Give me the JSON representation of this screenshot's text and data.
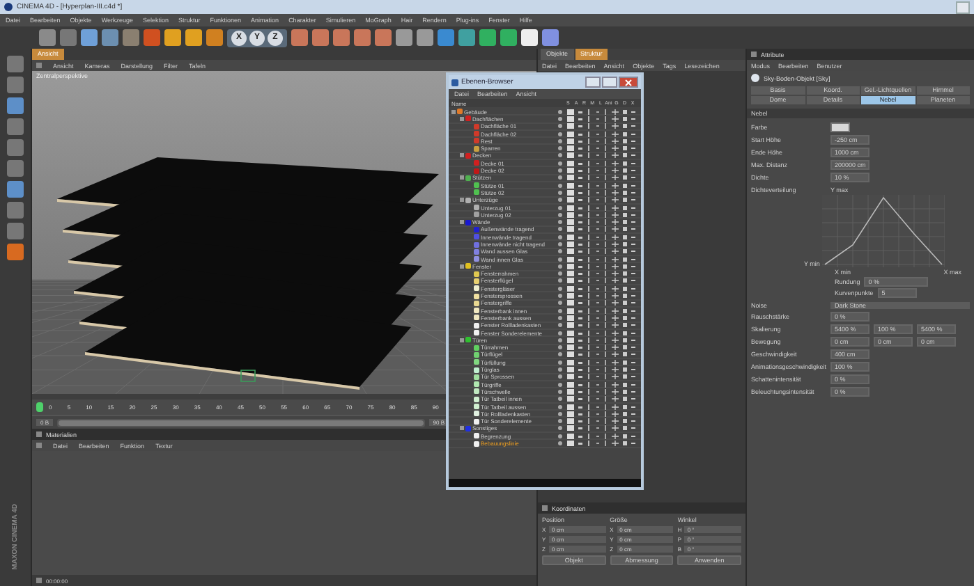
{
  "window": {
    "title": "CINEMA 4D - [Hyperplan-III.c4d *]"
  },
  "menu": [
    "Datei",
    "Bearbeiten",
    "Objekte",
    "Werkzeuge",
    "Selektion",
    "Struktur",
    "Funktionen",
    "Animation",
    "Charakter",
    "Simulieren",
    "MoGraph",
    "Hair",
    "Rendern",
    "Plug-ins",
    "Fenster",
    "Hilfe"
  ],
  "axis_buttons": [
    "X",
    "Y",
    "Z"
  ],
  "viewport": {
    "tab": "Ansicht",
    "menu": [
      "Ansicht",
      "Kameras",
      "Darstellung",
      "Filter",
      "Tafeln"
    ],
    "label": "Zentralperspektive"
  },
  "timeline": {
    "ticks": [
      "0",
      "5",
      "10",
      "15",
      "20",
      "25",
      "30",
      "35",
      "40",
      "45",
      "50",
      "55",
      "60",
      "65",
      "70",
      "75",
      "80",
      "85",
      "90"
    ],
    "start": "0 B",
    "end": "90 B",
    "range": {
      "level": 1
    }
  },
  "materials": {
    "title": "Materialien",
    "menu": [
      "Datei",
      "Bearbeiten",
      "Funktion",
      "Textur"
    ]
  },
  "logo": "MAXON CINEMA 4D",
  "status_bar": "00:00:00",
  "object_manager": {
    "tabs": [
      {
        "label": "Objekte",
        "selected": false
      },
      {
        "label": "Struktur",
        "selected": true
      }
    ],
    "menu": [
      "Datei",
      "Bearbeiten",
      "Ansicht",
      "Objekte",
      "Tags",
      "Lesezeichen"
    ]
  },
  "layer_browser": {
    "title": "Ebenen-Browser",
    "menu": [
      "Datei",
      "Bearbeiten",
      "Ansicht"
    ],
    "columns": [
      "Name",
      "S",
      "A",
      "R",
      "M",
      "L",
      "Ani",
      "G",
      "D",
      "X"
    ],
    "layers": [
      {
        "name": "Gebäude",
        "color": "#e07a2a",
        "selected": false,
        "children": [
          {
            "name": "Dachflächen",
            "color": "#d02020",
            "selected": false,
            "children": [
              {
                "name": "Dachfläche 01",
                "color": "#d03a2a",
                "selected": false
              },
              {
                "name": "Dachfläche 02",
                "color": "#d03a2a",
                "selected": false
              },
              {
                "name": "Rest",
                "color": "#d03a2a",
                "selected": false
              },
              {
                "name": "Sparren",
                "color": "#c8a040",
                "selected": false
              }
            ]
          },
          {
            "name": "Decken",
            "color": "#d02020",
            "selected": false,
            "children": [
              {
                "name": "Decke 01",
                "color": "#d02020",
                "selected": false
              },
              {
                "name": "Decke 02",
                "color": "#c01818",
                "selected": false
              }
            ]
          },
          {
            "name": "Stützen",
            "color": "#50b050",
            "selected": false,
            "children": [
              {
                "name": "Stütze 01",
                "color": "#50c050",
                "selected": false
              },
              {
                "name": "Stütze 02",
                "color": "#50c050",
                "selected": false
              }
            ]
          },
          {
            "name": "Unterzüge",
            "color": "#b0b0b0",
            "selected": false,
            "children": [
              {
                "name": "Unterzug 01",
                "color": "#b0b0b0",
                "selected": false
              },
              {
                "name": "Unterzug 02",
                "color": "#a0a0a0",
                "selected": false
              }
            ]
          },
          {
            "name": "Wände",
            "color": "#1818d0",
            "selected": false,
            "children": [
              {
                "name": "Außenwände tragend",
                "color": "#2020d0",
                "selected": false
              },
              {
                "name": "Innenwände tragend",
                "color": "#5050e0",
                "selected": false
              },
              {
                "name": "Innenwände nicht tragend",
                "color": "#7070e0",
                "selected": false
              },
              {
                "name": "Wand aussen Glas",
                "color": "#8080e0",
                "selected": false
              },
              {
                "name": "Wand innen Glas",
                "color": "#9090e0",
                "selected": false
              }
            ]
          },
          {
            "name": "Fenster",
            "color": "#e0c020",
            "selected": false,
            "children": [
              {
                "name": "Fensterrahmen",
                "color": "#e0c850",
                "selected": false
              },
              {
                "name": "Fensterflügel",
                "color": "#e8d070",
                "selected": false
              },
              {
                "name": "Fenstergläser",
                "color": "#f0f0d0",
                "selected": false
              },
              {
                "name": "Fenstersprossen",
                "color": "#f0e0a0",
                "selected": false
              },
              {
                "name": "Fenstergriffe",
                "color": "#e8d890",
                "selected": false
              },
              {
                "name": "Fensterbank innen",
                "color": "#f0e8c0",
                "selected": false
              },
              {
                "name": "Fensterbank aussen",
                "color": "#f0e8c0",
                "selected": false
              },
              {
                "name": "Fenster Rollladenkasten",
                "color": "#f0f0f0",
                "selected": false
              },
              {
                "name": "Fenster Sonderelemente",
                "color": "#f0f0f0",
                "selected": false
              }
            ]
          },
          {
            "name": "Türen",
            "color": "#30c030",
            "selected": false,
            "children": [
              {
                "name": "Türrahmen",
                "color": "#60d060",
                "selected": false
              },
              {
                "name": "Türflügel",
                "color": "#70d070",
                "selected": false
              },
              {
                "name": "Türfüllung",
                "color": "#80d880",
                "selected": false
              },
              {
                "name": "Türglas",
                "color": "#c0f0d0",
                "selected": false
              },
              {
                "name": "Tür Sprossen",
                "color": "#a0e0a0",
                "selected": false
              },
              {
                "name": "Türgriffe",
                "color": "#b0e8b0",
                "selected": false
              },
              {
                "name": "Türschwelle",
                "color": "#c0e8c0",
                "selected": false
              },
              {
                "name": "Tür Tatbeil innen",
                "color": "#d0f0d0",
                "selected": false
              },
              {
                "name": "Tür Tatbeil aussen",
                "color": "#d0f0d0",
                "selected": false
              },
              {
                "name": "Tür Rollladenkasten",
                "color": "#e0f0e0",
                "selected": false
              },
              {
                "name": "Tür Sonderelemente",
                "color": "#f0f0f0",
                "selected": false
              }
            ]
          },
          {
            "name": "Sonstiges",
            "color": "#2030e0",
            "selected": false,
            "children": [
              {
                "name": "Begrenzung",
                "color": "#f0f0f0",
                "selected": false
              },
              {
                "name": "Bebauungslinie",
                "color": "#f0f0f0",
                "selected": true
              }
            ]
          }
        ]
      }
    ]
  },
  "attributes": {
    "title": "Attribute",
    "menu": [
      "Modus",
      "Bearbeiten",
      "Benutzer"
    ],
    "object": "Sky-Boden-Objekt [Sky]",
    "tabs": [
      {
        "label": "Basis",
        "selected": false
      },
      {
        "label": "Koord.",
        "selected": false
      },
      {
        "label": "Gel.-Lichtquellen",
        "selected": false
      },
      {
        "label": "Himmel",
        "selected": false
      },
      {
        "label": "Dome",
        "selected": false
      },
      {
        "label": "Details",
        "selected": false
      },
      {
        "label": "Nebel",
        "selected": true
      },
      {
        "label": "Planeten",
        "selected": false
      }
    ],
    "section": "Nebel",
    "params": [
      {
        "kind": "color",
        "label": "Farbe",
        "color": "#d8d8d8"
      },
      {
        "kind": "field",
        "label": "Start Höhe",
        "values": [
          "-250 cm"
        ]
      },
      {
        "kind": "field",
        "label": "Ende Höhe",
        "values": [
          "1000 cm"
        ]
      },
      {
        "kind": "field",
        "label": "Max. Distanz",
        "values": [
          "200000 cm"
        ]
      },
      {
        "kind": "field",
        "label": "Dichte",
        "values": [
          "10 %"
        ]
      },
      {
        "kind": "curve",
        "label": "Dichteverteilung",
        "ymax": "Y max",
        "ymin": "Y min",
        "xmin": "X min",
        "xmax": "X max",
        "rounding_label": "Rundung",
        "rounding": "0 %",
        "points_label": "Kurvenpunkte",
        "points": "5"
      },
      {
        "kind": "dropdown",
        "label": "Noise",
        "values": [
          "Dark Stone"
        ]
      },
      {
        "kind": "field",
        "label": "Rauschstärke",
        "values": [
          "0 %"
        ]
      },
      {
        "kind": "field",
        "label": "Skalierung",
        "values": [
          "5400 %",
          "100 %",
          "5400 %"
        ]
      },
      {
        "kind": "field",
        "label": "Bewegung",
        "values": [
          "0 cm",
          "0 cm",
          "0 cm"
        ]
      },
      {
        "kind": "field",
        "label": "Geschwindigkeit",
        "values": [
          "400 cm"
        ]
      },
      {
        "kind": "field",
        "label": "Animationsgeschwindigkeit",
        "values": [
          "100 %"
        ]
      },
      {
        "kind": "field",
        "label": "Schattenintensität",
        "values": [
          "0 %"
        ]
      },
      {
        "kind": "field",
        "label": "Beleuchtungsintensität",
        "values": [
          "0 %"
        ]
      }
    ]
  },
  "coordinates": {
    "title": "Koordinaten",
    "columns": [
      "Position",
      "Größe",
      "Winkel"
    ],
    "rows": [
      {
        "axis": "X",
        "position": "0 cm",
        "size_axis": "X",
        "size": "0 cm",
        "angle_axis": "H",
        "angle": "0 °"
      },
      {
        "axis": "Y",
        "position": "0 cm",
        "size_axis": "Y",
        "size": "0 cm",
        "angle_axis": "P",
        "angle": "0 °"
      },
      {
        "axis": "Z",
        "position": "0 cm",
        "size_axis": "Z",
        "size": "0 cm",
        "angle_axis": "B",
        "angle": "0 °"
      }
    ],
    "buttons": [
      "Objekt",
      "Abmessung",
      "Anwenden"
    ]
  }
}
